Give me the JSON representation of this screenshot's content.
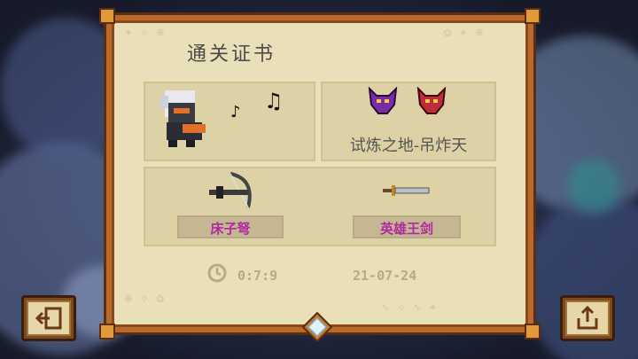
{
  "certificate": {
    "title": "通关证书",
    "stage_name": "试炼之地-吊炸天",
    "time": "0:7:9",
    "date": "21-07-24"
  },
  "weapons": [
    {
      "label": "床子弩",
      "icon": "crossbow-icon"
    },
    {
      "label": "英雄王剑",
      "icon": "sword-icon"
    }
  ],
  "colors": {
    "frame": "#b86a2c",
    "paper": "#e9dfb8",
    "badge_text": "#b02aa0",
    "title_text": "#4a4a4a"
  },
  "buttons": {
    "exit_icon": "exit-icon",
    "share_icon": "share-icon"
  }
}
